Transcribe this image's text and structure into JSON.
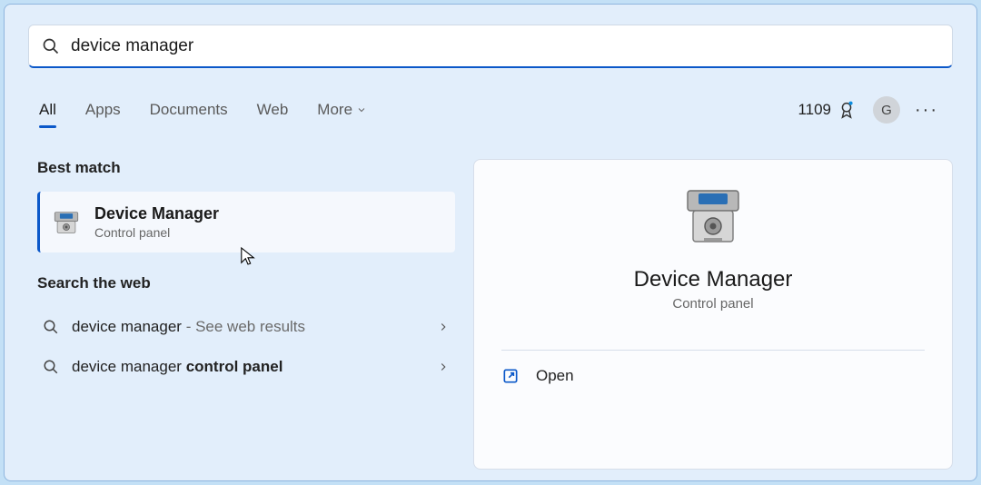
{
  "search": {
    "value": "device manager"
  },
  "tabs": {
    "all": "All",
    "apps": "Apps",
    "documents": "Documents",
    "web": "Web",
    "more": "More"
  },
  "header": {
    "points": "1109",
    "avatar_initial": "G"
  },
  "left": {
    "best_match_label": "Best match",
    "best_match": {
      "title": "Device Manager",
      "subtitle": "Control panel"
    },
    "search_web_label": "Search the web",
    "web_items": [
      {
        "prefix": "device manager",
        "suffix": " - See web results",
        "bold_suffix": ""
      },
      {
        "prefix": "device manager ",
        "suffix": "",
        "bold_suffix": "control panel"
      }
    ]
  },
  "detail": {
    "title": "Device Manager",
    "subtitle": "Control panel",
    "open_label": "Open"
  }
}
